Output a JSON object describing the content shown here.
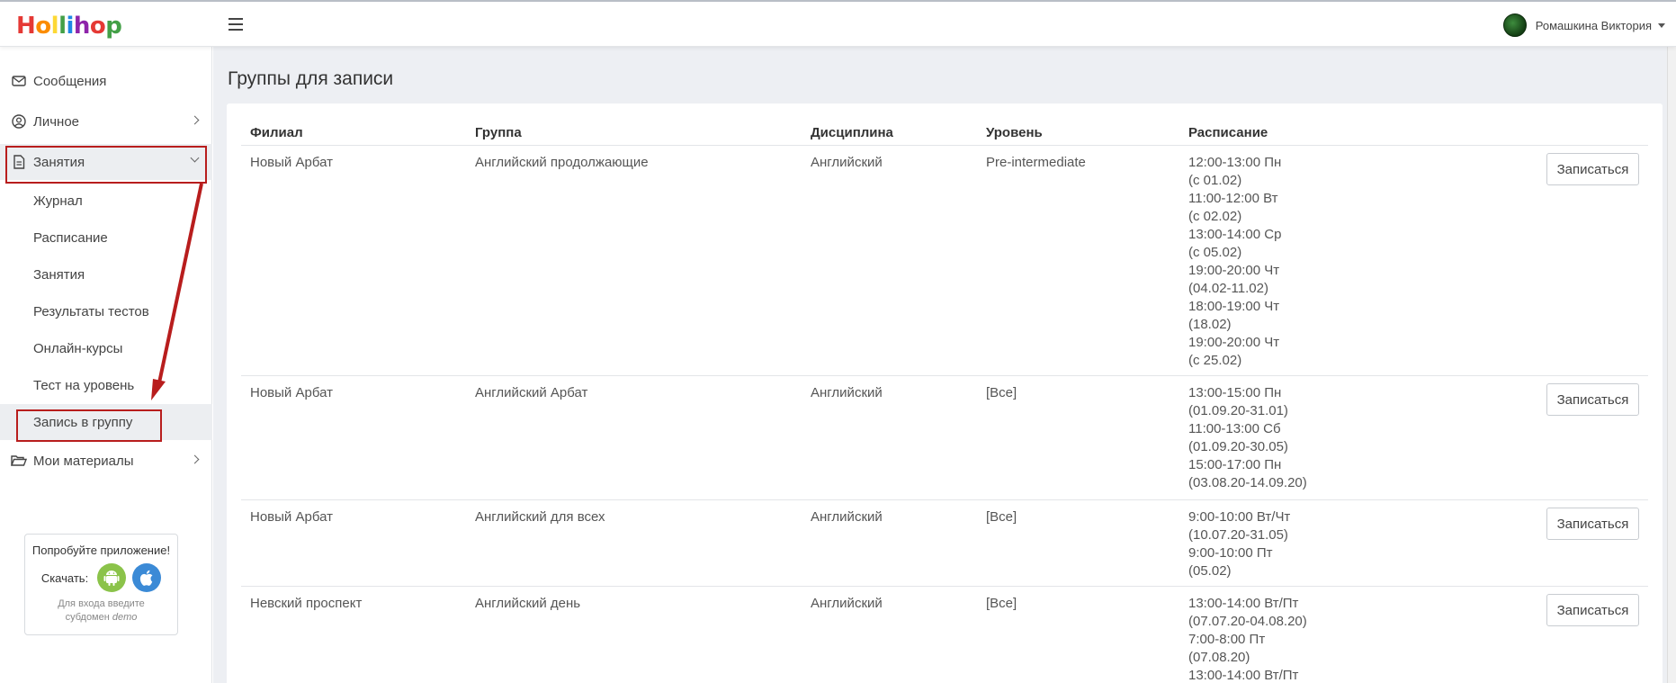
{
  "app": {
    "logo_text": "Hollihop",
    "logo_letters": [
      {
        "ch": "H",
        "color": "#e53935"
      },
      {
        "ch": "o",
        "color": "#fb8c00"
      },
      {
        "ch": "l",
        "color": "#fdd835"
      },
      {
        "ch": "l",
        "color": "#43a047"
      },
      {
        "ch": "i",
        "color": "#1e88e5"
      },
      {
        "ch": "h",
        "color": "#8e24aa"
      },
      {
        "ch": "o",
        "color": "#e53935"
      },
      {
        "ch": "p",
        "color": "#43a047"
      }
    ],
    "user_name": "Ромашкина Виктория"
  },
  "sidebar": {
    "items": [
      {
        "label": "Сообщения",
        "icon": "envelope-icon"
      },
      {
        "label": "Личное",
        "icon": "user-circle-icon"
      },
      {
        "label": "Занятия",
        "icon": "document-icon"
      },
      {
        "label": "Мои материалы",
        "icon": "folder-open-icon"
      }
    ],
    "sub_items": [
      {
        "label": "Журнал"
      },
      {
        "label": "Расписание"
      },
      {
        "label": "Занятия"
      },
      {
        "label": "Результаты тестов"
      },
      {
        "label": "Онлайн-курсы"
      },
      {
        "label": "Тест на уровень"
      },
      {
        "label": "Запись в группу"
      }
    ],
    "promo": {
      "title": "Попробуйте приложение!",
      "download_label": "Скачать:",
      "hint_line1": "Для входа введите",
      "hint_line2_prefix": "субдомен ",
      "hint_line2_em": "demo"
    }
  },
  "main": {
    "title": "Группы для записи",
    "columns": [
      "Филиал",
      "Группа",
      "Дисциплина",
      "Уровень",
      "Расписание"
    ],
    "enroll_label": "Записаться",
    "rows": [
      {
        "branch": "Новый Арбат",
        "group": "Английский продолжающие",
        "discipline": "Английский",
        "level": "Pre-intermediate",
        "schedule": [
          "12:00-13:00 Пн",
          "(с 01.02)",
          "11:00-12:00 Вт",
          "(с 02.02)",
          "13:00-14:00 Ср",
          "(с 05.02)",
          "19:00-20:00 Чт",
          "(04.02-11.02)",
          "18:00-19:00 Чт",
          "(18.02)",
          "19:00-20:00 Чт",
          "(с 25.02)"
        ]
      },
      {
        "branch": "Новый Арбат",
        "group": "Английский Арбат",
        "discipline": "Английский",
        "level": "[Все]",
        "schedule": [
          "13:00-15:00 Пн",
          "(01.09.20-31.01)",
          "11:00-13:00 Сб",
          "(01.09.20-30.05)",
          "15:00-17:00 Пн",
          "(03.08.20-14.09.20)"
        ]
      },
      {
        "branch": "Новый Арбат",
        "group": "Английский для всех",
        "discipline": "Английский",
        "level": "[Все]",
        "schedule": [
          "9:00-10:00 Вт/Чт",
          "(10.07.20-31.05)",
          "9:00-10:00 Пт",
          "(05.02)"
        ]
      },
      {
        "branch": "Невский проспект",
        "group": "Английский день",
        "discipline": "Английский",
        "level": "[Все]",
        "schedule": [
          "13:00-14:00 Вт/Пт",
          "(07.07.20-04.08.20)",
          "7:00-8:00 Пт",
          "(07.08.20)",
          "13:00-14:00 Вт/Пт"
        ]
      }
    ]
  },
  "colors": {
    "highlight": "#b81d1d",
    "content_bg": "#edeff3",
    "active_bg": "#eceef1"
  }
}
